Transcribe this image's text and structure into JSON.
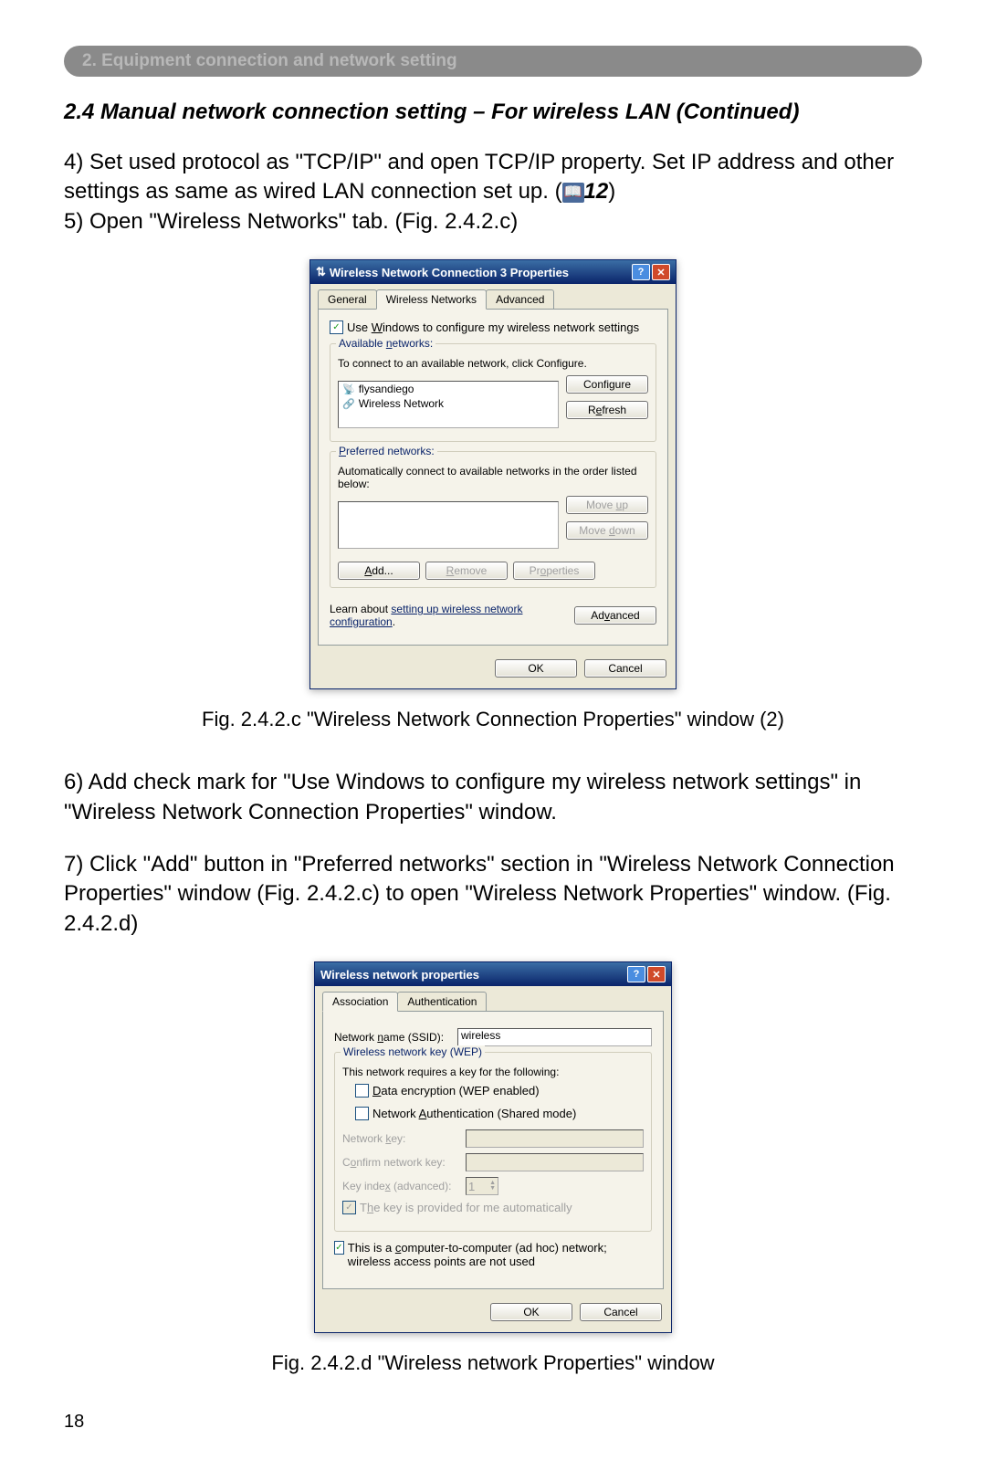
{
  "section_header": "2. Equipment connection and network setting",
  "subheading": "2.4 Manual network connection setting – For wireless LAN (Continued)",
  "body_text_1": "4) Set used protocol as \"TCP/IP\" and open TCP/IP property. Set IP address and other settings as same as wired LAN connection set up. (",
  "ref_number": "12",
  "body_text_1_end": ")",
  "body_text_2": "5) Open \"Wireless Networks\" tab. (Fig. 2.4.2.c)",
  "fig1_caption": "Fig. 2.4.2.c \"Wireless Network Connection Properties\" window (2)",
  "body_text_3": "6) Add check mark for \"Use Windows to configure my wireless network settings\" in \"Wireless Network Connection Properties\" window.",
  "body_text_4": "7) Click \"Add\" button in \"Preferred networks\" section in \"Wireless Network Connection Properties\" window (Fig. 2.4.2.c) to open \"Wireless Network Properties\" window. (Fig. 2.4.2.d)",
  "fig2_caption": "Fig. 2.4.2.d \"Wireless network Properties\" window",
  "page_number": "18",
  "dialog1": {
    "title": "Wireless Network Connection 3 Properties",
    "tabs": {
      "general": "General",
      "wireless": "Wireless Networks",
      "advanced": "Advanced"
    },
    "checkbox_label": "Use Windows to configure my wireless network settings",
    "available_title": "Available networks:",
    "available_hint": "To connect to an available network, click Configure.",
    "net1": "flysandiego",
    "net2": "Wireless Network",
    "configure_btn": "Configure",
    "refresh_btn": "Refresh",
    "preferred_title": "Preferred networks:",
    "preferred_hint": "Automatically connect to available networks in the order listed below:",
    "moveup_btn": "Move up",
    "movedown_btn": "Move down",
    "add_btn": "Add...",
    "remove_btn": "Remove",
    "properties_btn": "Properties",
    "learn_about": "Learn about ",
    "learn_link": "setting up wireless network configuration",
    "advanced_btn": "Advanced",
    "ok_btn": "OK",
    "cancel_btn": "Cancel"
  },
  "dialog2": {
    "title": "Wireless network properties",
    "tabs": {
      "assoc": "Association",
      "auth": "Authentication"
    },
    "ssid_label": "Network name (SSID):",
    "ssid_value": "wireless",
    "wep_group": "Wireless network key (WEP)",
    "wep_hint": "This network requires a key for the following:",
    "data_enc": "Data encryption (WEP enabled)",
    "net_auth": "Network Authentication (Shared mode)",
    "netkey_label": "Network key:",
    "confirm_label": "Confirm network key:",
    "keyindex_label": "Key index (advanced):",
    "keyindex_value": "1",
    "auto_key": "The key is provided for me automatically",
    "adhoc_label": "This is a computer-to-computer (ad hoc) network; wireless access points are not used",
    "ok_btn": "OK",
    "cancel_btn": "Cancel"
  }
}
